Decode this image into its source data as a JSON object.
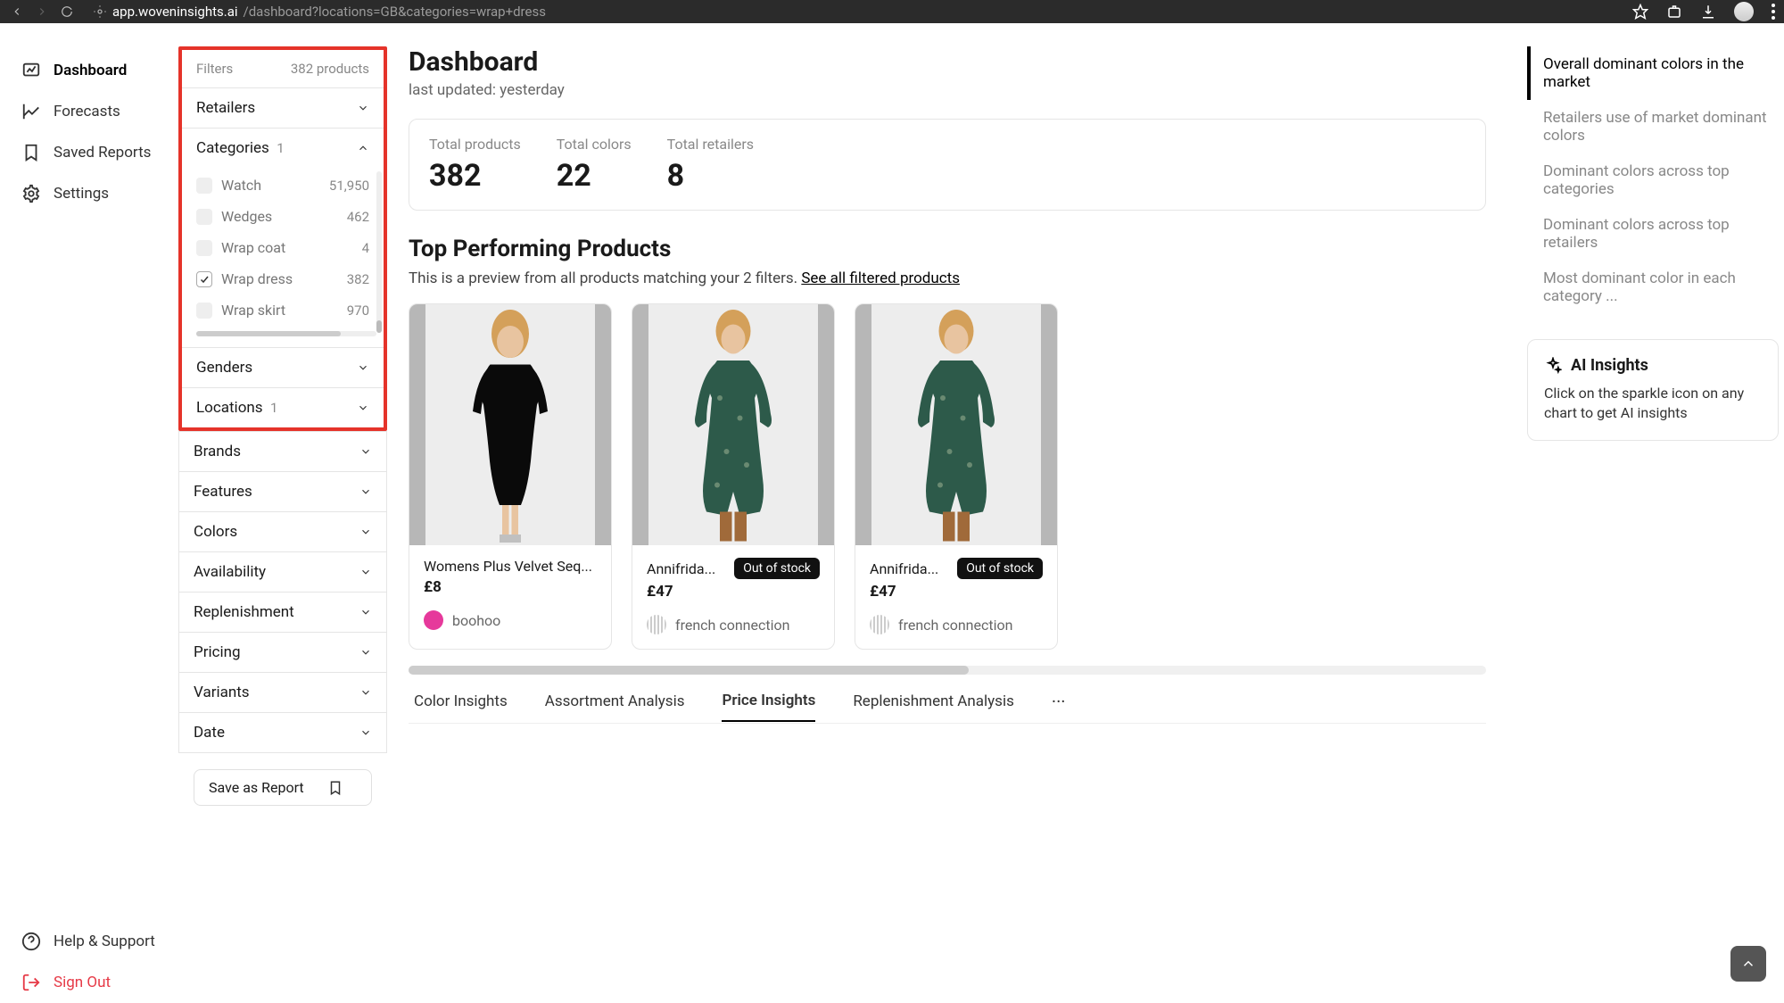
{
  "browser": {
    "url_host": "app.woveninsights.ai",
    "url_path": "/dashboard?locations=GB&categories=wrap+dress"
  },
  "nav": {
    "items": [
      {
        "label": "Dashboard",
        "icon": "dashboard",
        "active": true
      },
      {
        "label": "Forecasts",
        "icon": "forecasts"
      },
      {
        "label": "Saved Reports",
        "icon": "bookmark"
      },
      {
        "label": "Settings",
        "icon": "gear"
      }
    ],
    "help": "Help & Support",
    "signout": "Sign Out"
  },
  "filters": {
    "header_label": "Filters",
    "product_count": "382 products",
    "sections": {
      "retailers": "Retailers",
      "categories": {
        "label": "Categories",
        "count": "1"
      },
      "genders": "Genders",
      "locations": {
        "label": "Locations",
        "count": "1"
      },
      "brands": "Brands",
      "features": "Features",
      "colors": "Colors",
      "availability": "Availability",
      "replenishment": "Replenishment",
      "pricing": "Pricing",
      "variants": "Variants",
      "date": "Date"
    },
    "categories_items": [
      {
        "label": "Watch",
        "count": "51,950",
        "checked": false
      },
      {
        "label": "Wedges",
        "count": "462",
        "checked": false
      },
      {
        "label": "Wrap coat",
        "count": "4",
        "checked": false
      },
      {
        "label": "Wrap dress",
        "count": "382",
        "checked": true
      },
      {
        "label": "Wrap skirt",
        "count": "970",
        "checked": false
      }
    ],
    "save_report": "Save as Report"
  },
  "main": {
    "title": "Dashboard",
    "last_updated": "last updated: yesterday",
    "stats": [
      {
        "label": "Total products",
        "value": "382"
      },
      {
        "label": "Total colors",
        "value": "22"
      },
      {
        "label": "Total retailers",
        "value": "8"
      }
    ],
    "top_products_heading": "Top Performing Products",
    "preview_text": "This is a preview from all products matching your 2 filters. ",
    "preview_link": "See all filtered products",
    "products": [
      {
        "name": "Womens Plus Velvet Seq...",
        "price": "£8",
        "retailer": "boohoo",
        "rdot": "boo",
        "out_of_stock": false,
        "style": "black"
      },
      {
        "name": "Annifrida...",
        "price": "£47",
        "retailer": "french connection",
        "rdot": "fc",
        "out_of_stock": true,
        "style": "green"
      },
      {
        "name": "Annifrida...",
        "price": "£47",
        "retailer": "french connection",
        "rdot": "fc",
        "out_of_stock": true,
        "style": "green"
      }
    ],
    "out_of_stock_label": "Out of stock",
    "tabs": [
      {
        "label": "Color Insights"
      },
      {
        "label": "Assortment Analysis"
      },
      {
        "label": "Price Insights",
        "active": true
      },
      {
        "label": "Replenishment Analysis"
      }
    ]
  },
  "toc": [
    {
      "label": "Overall dominant colors in the market",
      "active": true
    },
    {
      "label": "Retailers use of market dominant colors"
    },
    {
      "label": "Dominant colors across top categories"
    },
    {
      "label": "Dominant colors across top retailers"
    },
    {
      "label": "Most dominant color in each category ..."
    }
  ],
  "ai": {
    "heading": "AI Insights",
    "text": "Click on the sparkle icon on any chart to get AI insights"
  }
}
